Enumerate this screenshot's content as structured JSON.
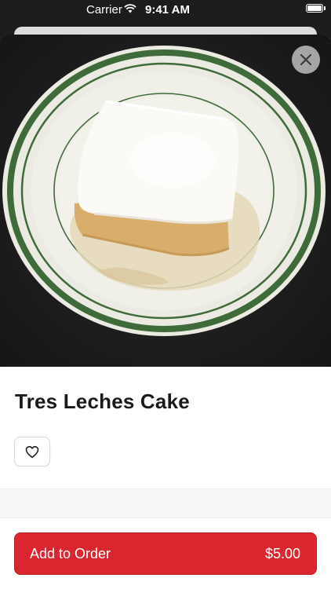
{
  "status_bar": {
    "carrier": "Carrier",
    "time": "9:41 AM",
    "icons": [
      "wifi-icon",
      "battery-icon"
    ]
  },
  "item": {
    "name": "Tres Leches Cake",
    "image": "tres-leches-cake-photo"
  },
  "actions": {
    "close_icon": "close-icon",
    "favorite_icon": "heart-icon"
  },
  "order_button": {
    "label": "Add to Order",
    "price": "$5.00"
  },
  "colors": {
    "primary": "#d9262f",
    "plate_rim": "#3f6b3a",
    "cream": "#fbfaf6",
    "sponge": "#d9ae6c"
  }
}
